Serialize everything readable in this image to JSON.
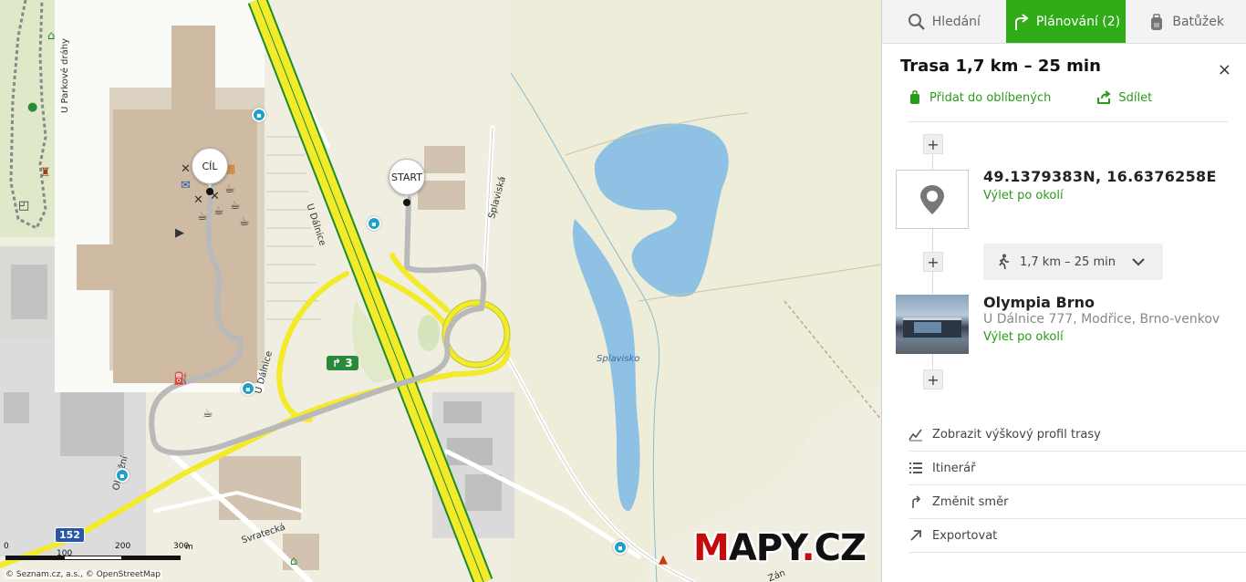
{
  "map": {
    "labels": {
      "parkove_drahy": "U Parkové dráhy",
      "u_dalnice_1": "U Dálnice",
      "u_dalnice_2": "U Dálnice",
      "splaviska_road": "Splaviská",
      "splavisko_lake": "Splavisko",
      "svratecka": "Svratecká",
      "okruzni": "Okružní",
      "zan": "Zán"
    },
    "pins": {
      "start": "START",
      "cil": "CÍL"
    },
    "road_badges": {
      "exit": "3",
      "route": "152"
    },
    "scale": {
      "ticks": [
        "0",
        "100",
        "200",
        "300"
      ],
      "unit": "m"
    },
    "credits": "© Seznam.cz, a.s., © OpenStreetMap",
    "logo": {
      "m": "M",
      "apy": "APY",
      "dot": ".",
      "cz": "CZ"
    },
    "colors": {
      "route": "#b9b9b9",
      "highway": "#f3ea2a",
      "highway_edge": "#1e8a2a",
      "water": "#8ec1e3",
      "buildings": "#d5c6b1"
    }
  },
  "panel": {
    "tabs": [
      {
        "label": "Hledání",
        "icon": "search-icon",
        "active": false
      },
      {
        "label": "Plánování (2)",
        "icon": "route-planning-icon",
        "active": true
      },
      {
        "label": "Batůžek",
        "icon": "backpack-icon",
        "active": false
      }
    ],
    "accent": "#2fac17",
    "route": {
      "title": "Trasa 1,7 km – 25 min",
      "close": "×",
      "add_favorites": "Přidat do oblíbených",
      "share": "Sdílet"
    },
    "stops": [
      {
        "title": "49.1379383N,  16.6376258E",
        "subtitle": "",
        "trip": "Výlet po okolí",
        "icon": "map-pin-icon"
      },
      {
        "title": "Olympia Brno",
        "subtitle": "U Dálnice 777, Modřice, Brno-venkov",
        "trip": "Výlet po okolí",
        "icon": "photo-thumbnail"
      }
    ],
    "segment": {
      "mode": "walking-icon",
      "summary": "1,7 km – 25 min"
    },
    "plus": "+",
    "menu": [
      {
        "label": "Zobrazit výškový profil trasy",
        "icon": "elevation-profile-icon"
      },
      {
        "label": "Itinerář",
        "icon": "list-icon"
      },
      {
        "label": "Změnit směr",
        "icon": "reverse-direction-icon"
      },
      {
        "label": "Exportovat",
        "icon": "export-icon"
      }
    ]
  }
}
